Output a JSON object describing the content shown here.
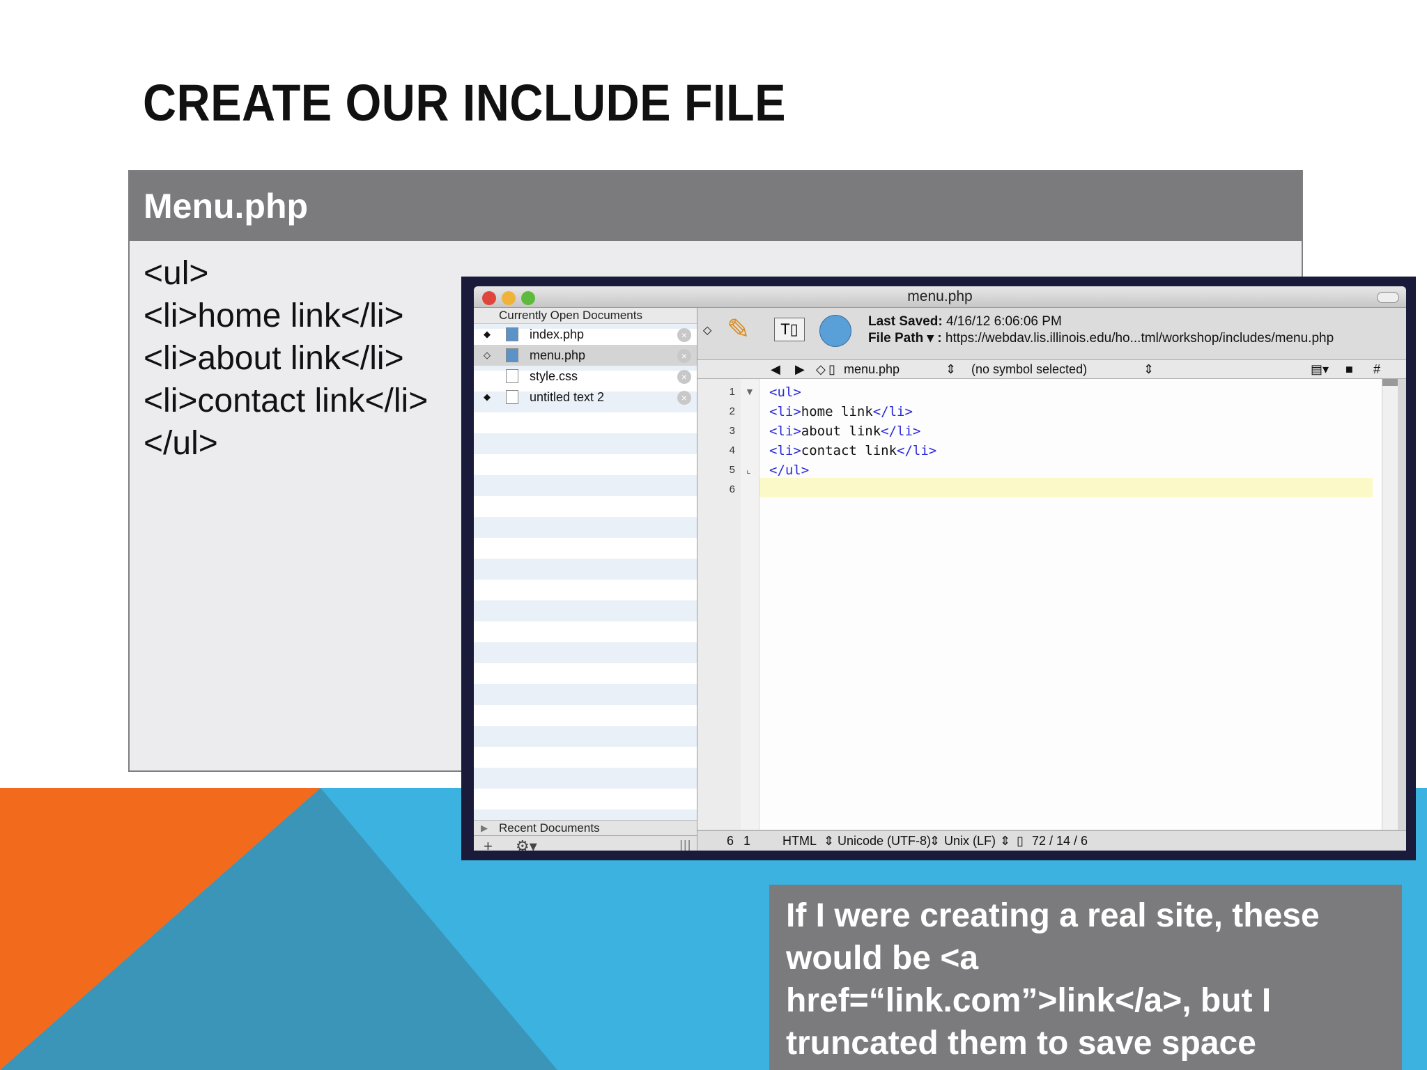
{
  "slide": {
    "title": "CREATE OUR INCLUDE FILE"
  },
  "card": {
    "header": "Menu.php",
    "code_lines": [
      "<ul>",
      "<li>home link</li>",
      "<li>about link</li>",
      "<li>contact link</li>",
      "</ul>"
    ]
  },
  "editor": {
    "window_title": "menu.php",
    "sidebar": {
      "heading": "Currently Open Documents",
      "documents": [
        {
          "name": "index.php",
          "mark": "◆"
        },
        {
          "name": "menu.php",
          "mark": "◇"
        },
        {
          "name": "style.css",
          "mark": ""
        },
        {
          "name": "untitled text 2",
          "mark": "◆"
        }
      ],
      "recent_label": "Recent Documents",
      "footer_add": "+",
      "footer_gear": "⚙▾",
      "footer_grip": "|||"
    },
    "toolbar": {
      "last_saved_label": "Last Saved:",
      "last_saved_value": "4/16/12 6:06:06 PM",
      "file_path_label": "File Path ▾ :",
      "file_path_value": "https://webdav.lis.illinois.edu/ho...tml/workshop/includes/menu.php",
      "tbox_glyph": "T▯"
    },
    "navbar": {
      "back": "◀",
      "forward": "▶",
      "diamond": "◇",
      "file": "menu.php",
      "symbol": "(no symbol selected)",
      "hash": "#",
      "updown": "⇕"
    },
    "line_numbers": [
      "1",
      "2",
      "3",
      "4",
      "5",
      "6"
    ],
    "code_lines": [
      {
        "open": "<ul>",
        "text": "",
        "close": ""
      },
      {
        "open": "<li>",
        "text": "home link",
        "close": "</li>"
      },
      {
        "open": "<li>",
        "text": "about link",
        "close": "</li>"
      },
      {
        "open": "<li>",
        "text": "contact link",
        "close": "</li>"
      },
      {
        "open": "</ul>",
        "text": "",
        "close": ""
      },
      {
        "open": "",
        "text": "",
        "close": ""
      }
    ],
    "status": {
      "line": "6",
      "col": "1",
      "language": "HTML",
      "encoding": "Unicode (UTF-8)",
      "line_endings": "Unix (LF)",
      "counts": "72 / 14 / 6"
    }
  },
  "note": {
    "text": "If I were creating a real site, these would be <a href=“link.com”>link</a>, but I truncated them to save space"
  },
  "colors": {
    "orange": "#f26b1d",
    "blue": "#3bb2e0",
    "steel": "#3b95b8",
    "card_header": "#7b7b7d",
    "tag": "#2a2ad8"
  }
}
